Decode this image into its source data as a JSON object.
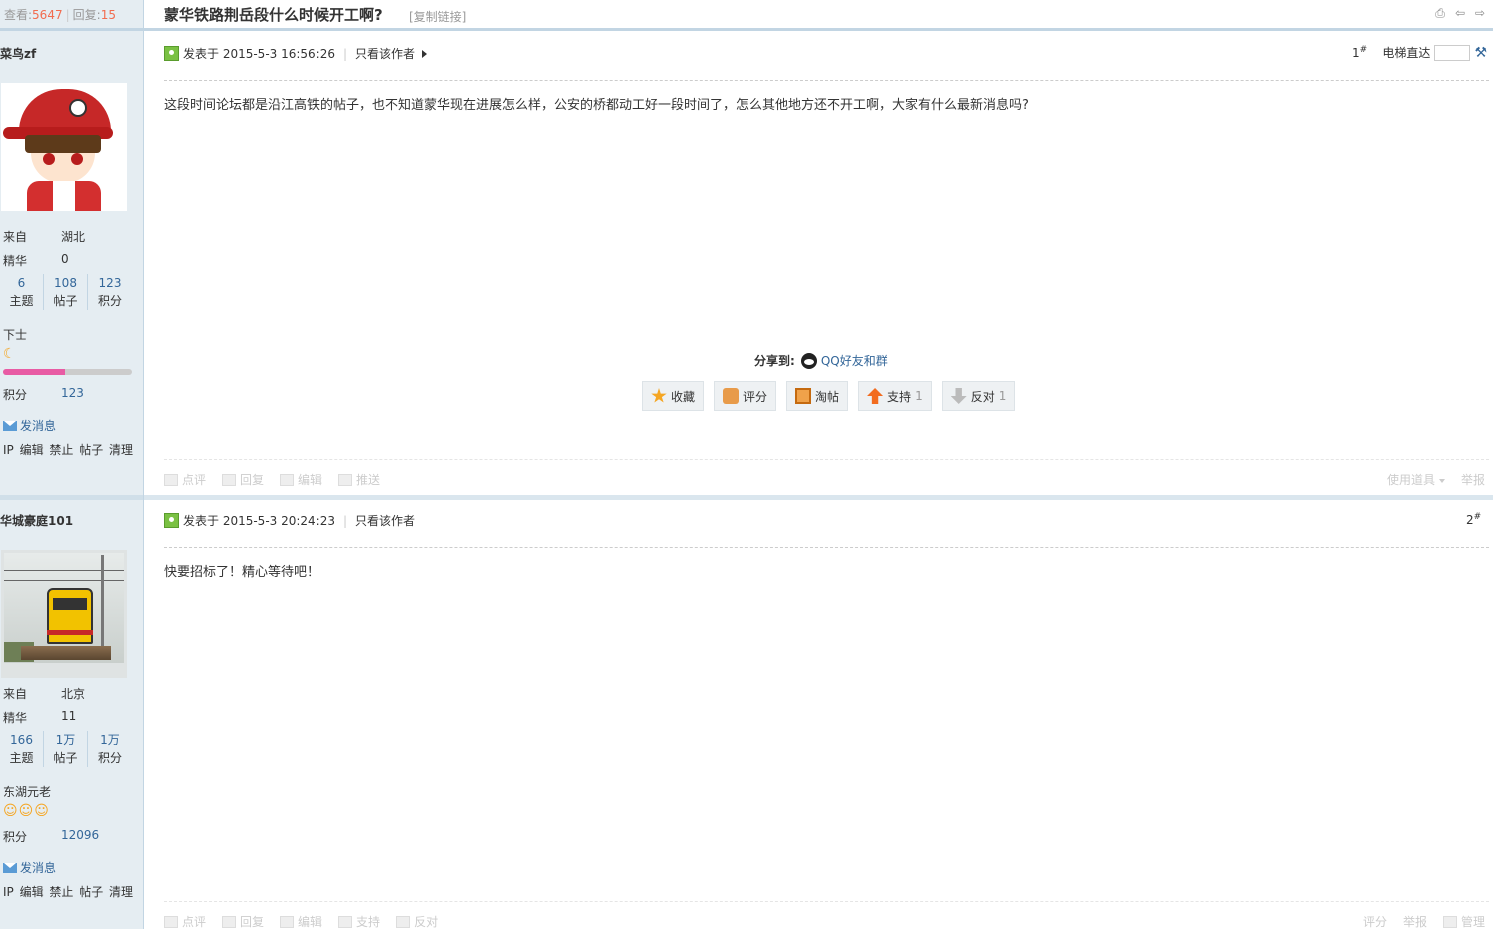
{
  "header": {
    "views_label": "查看:",
    "views": "5647",
    "replies_label": "回复:",
    "replies": "15",
    "title": "蒙华铁路荆岳段什么时候开工啊?",
    "copy_link": "[复制链接]",
    "icons": [
      "print-icon",
      "prev-thread-icon",
      "next-thread-icon"
    ]
  },
  "posts": [
    {
      "author": "菜鸟zf",
      "from_label": "来自",
      "from": "湖北",
      "digest_label": "精华",
      "digest": "0",
      "stats": [
        {
          "num": "6",
          "label": "主题"
        },
        {
          "num": "108",
          "label": "帖子"
        },
        {
          "num": "123",
          "label": "积分"
        }
      ],
      "rank": "下士",
      "rank_icon": "moon-icon",
      "progress": 0.5,
      "points_label": "积分",
      "points": "123",
      "send_msg": "发消息",
      "admin": "IP 编辑 禁止 帖子 清理",
      "posted_at": "发表于 2015-5-3 16:56:26",
      "only_author": "只看该作者",
      "floor": "1",
      "floor_sup": "#",
      "elevator_label": "电梯直达",
      "content": "这段时间论坛都是沿江高铁的帖子，也不知道蒙华现在进展怎么样，公安的桥都动工好一段时间了，怎么其他地方还不开工啊，大家有什么最新消息吗?",
      "share_label": "分享到:",
      "share_qq": "QQ好友和群",
      "buttons": {
        "favorite": "收藏",
        "rate": "评分",
        "tao": "淘帖",
        "support": "支持",
        "support_count": "1",
        "oppose": "反对",
        "oppose_count": "1"
      },
      "actions": [
        "点评",
        "回复",
        "编辑",
        "推送"
      ],
      "actions_right": [
        "使用道具",
        "举报"
      ]
    },
    {
      "author": "华城豪庭101",
      "from_label": "来自",
      "from": "北京",
      "digest_label": "精华",
      "digest": "11",
      "stats": [
        {
          "num": "166",
          "label": "主题"
        },
        {
          "num": "1万",
          "label": "帖子"
        },
        {
          "num": "1万",
          "label": "积分"
        }
      ],
      "rank": "东湖元老",
      "rank_icon": "smiley-icon",
      "points_label": "积分",
      "points": "12096",
      "send_msg": "发消息",
      "admin": "IP 编辑 禁止 帖子 清理",
      "posted_at": "发表于 2015-5-3 20:24:23",
      "only_author": "只看该作者",
      "floor": "2",
      "floor_sup": "#",
      "content": "快要招标了！精心等待吧！",
      "actions": [
        "点评",
        "回复",
        "编辑",
        "支持",
        "反对"
      ],
      "actions_right": [
        "评分",
        "举报",
        "管理"
      ]
    }
  ],
  "colors": {
    "sidebar_bg": "#e5edf2",
    "border": "#c2d5e3",
    "link": "#336699",
    "count_accent": "#f26c4f",
    "progress_fill": "#e85ba4"
  }
}
